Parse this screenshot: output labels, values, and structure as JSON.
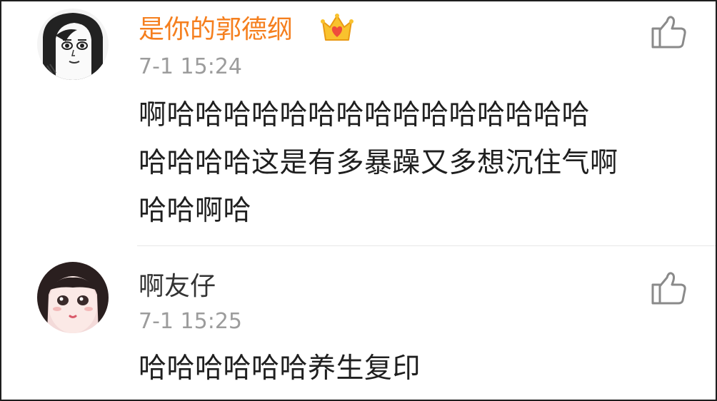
{
  "comments": [
    {
      "username": "是你的郭德纲",
      "badge_icon": "vip-crown-icon",
      "username_color": "#f57f1e",
      "timestamp": "7-1 15:24",
      "text": "啊哈哈哈哈哈哈哈哈哈哈哈哈哈哈哈\n哈哈哈哈这是有多暴躁又多想沉住气啊\n哈哈啊哈",
      "like_icon": "thumbs-up-icon"
    },
    {
      "username": "啊友仔",
      "timestamp": "7-1 15:25",
      "text": "哈哈哈哈哈哈养生复印",
      "like_icon": "thumbs-up-icon"
    }
  ]
}
